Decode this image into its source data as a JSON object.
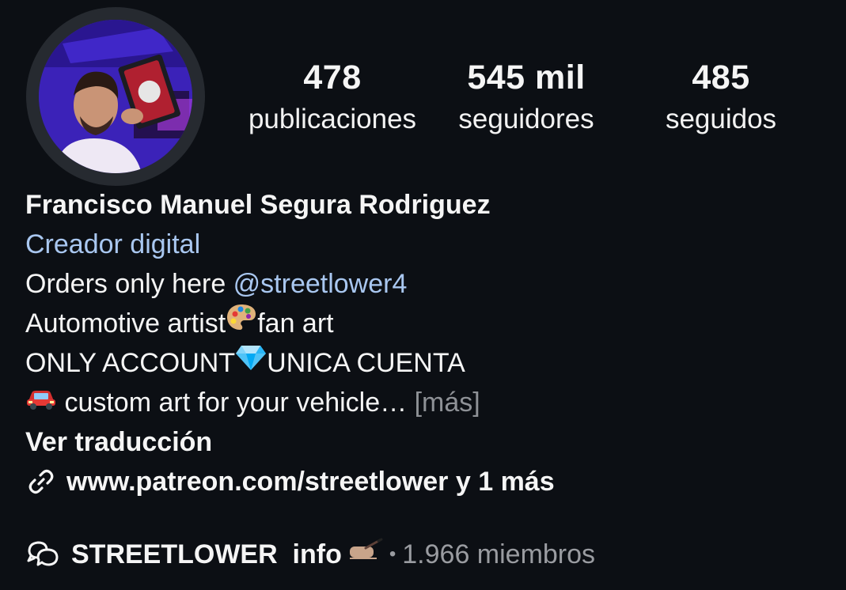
{
  "profile": {
    "avatar_icon": "profile-photo",
    "stats": {
      "posts": {
        "value": "478",
        "label": "publicaciones"
      },
      "followers": {
        "value": "545 mil",
        "label": "seguidores"
      },
      "following": {
        "value": "485",
        "label": "seguidos"
      }
    },
    "name": "Francisco Manuel Segura Rodriguez",
    "category": "Creador digital",
    "bio": {
      "line1_text": "Orders only here ",
      "line1_mention": "@streetlower4",
      "line2_a": "Automotive artist",
      "line2_emoji": "artist-palette-emoji",
      "line2_b": "fan art",
      "line3_a": "ONLY ACCOUNT",
      "line3_emoji": "gem-emoji",
      "line3_b": "UNICA CUENTA",
      "line4_emoji": "car-emoji",
      "line4_text": " custom art for your vehicle… ",
      "more": "[más]"
    },
    "translate": "Ver traducción",
    "link": {
      "icon": "link-icon",
      "text": "www.patreon.com/streetlower y 1 más"
    },
    "channel": {
      "icon": "broadcast-chat-icon",
      "name": "STREETLOWER  info",
      "emoji": "writing-hand-emoji",
      "separator": "•",
      "members": "1.966 miembros"
    }
  },
  "colors": {
    "background": "#0c0f14",
    "text": "#f5f5f5",
    "link_blue": "#a9c7f0",
    "muted": "#8e9196"
  }
}
